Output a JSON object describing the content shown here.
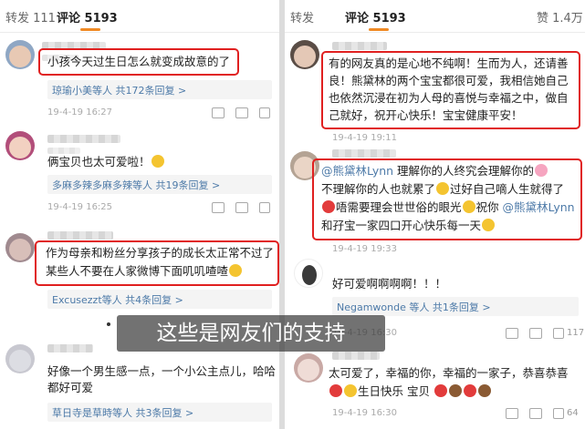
{
  "left": {
    "tab_forward": "转发 111",
    "tab_comments": "评论 5193",
    "comments": [
      {
        "text_lines": [
          "小孩今天过生日怎么就变成故意的了"
        ],
        "reply": "琼瑜小美等人  共172条回复 >",
        "date": "19-4-19 16:27"
      },
      {
        "text_lines": [
          "俩宝贝也太可爱啦！"
        ],
        "reply": "多麻多辣多麻多辣等人  共19条回复 >",
        "date": "19-4-19 16:25"
      },
      {
        "text_lines": [
          "作为母亲和粉丝分享孩子的成长太正常不过了",
          "某些人不要在人家微博下面叽叽喳喳"
        ],
        "reply": "Excusezzt等人  共4条回复 >",
        "date": "19-4-19 16:44"
      },
      {
        "text_lines": [
          "好像一个男生感一点，一个小公主点儿，哈哈",
          "都好可爱"
        ],
        "reply": "草日寺是草時等人  共3条回复 >",
        "date": ""
      }
    ]
  },
  "right": {
    "tab_forward": "转发",
    "tab_comments": "评论 5193",
    "tab_likes": "赞 1.4万",
    "comments": [
      {
        "text_lines": [
          "有的网友真的是心地不纯啊！生而为人，还请善",
          "良！熊黛林的两个宝宝都很可爱，我相信她自己",
          "也依然沉浸在初为人母的喜悦与幸福之中，做自",
          "己就好，祝开心快乐！宝宝健康平安！"
        ],
        "date": "19-4-19 19:11"
      },
      {
        "line1": {
          "mention": "@熊黛林Lynn",
          "text": " 理解你的人终究会理解你的"
        },
        "line2": "不理解你的人也就累了",
        "line2b": "过好自己嘀人生就得了",
        "line3": "唔需要理会世世俗的眼光",
        "line3b": "祝你",
        "line3mention": "@熊黛林Lynn",
        "line4": "和孖宝一家四口开心快乐每一天",
        "date": "19-4-19 19:33"
      },
      {
        "text_lines": [
          "好可爱啊啊啊啊！！！"
        ],
        "reply": "Negamwonde 等人  共1条回复 >",
        "date": "19-4-19 16:30",
        "likes": "117"
      },
      {
        "text_lines": [
          "太可爱了，幸福的你，幸福的一家子，恭喜恭喜"
        ],
        "line2": "生日快乐 宝贝",
        "date": "19-4-19 16:30",
        "likes": "64"
      }
    ]
  },
  "caption": "这些是网友们的支持"
}
